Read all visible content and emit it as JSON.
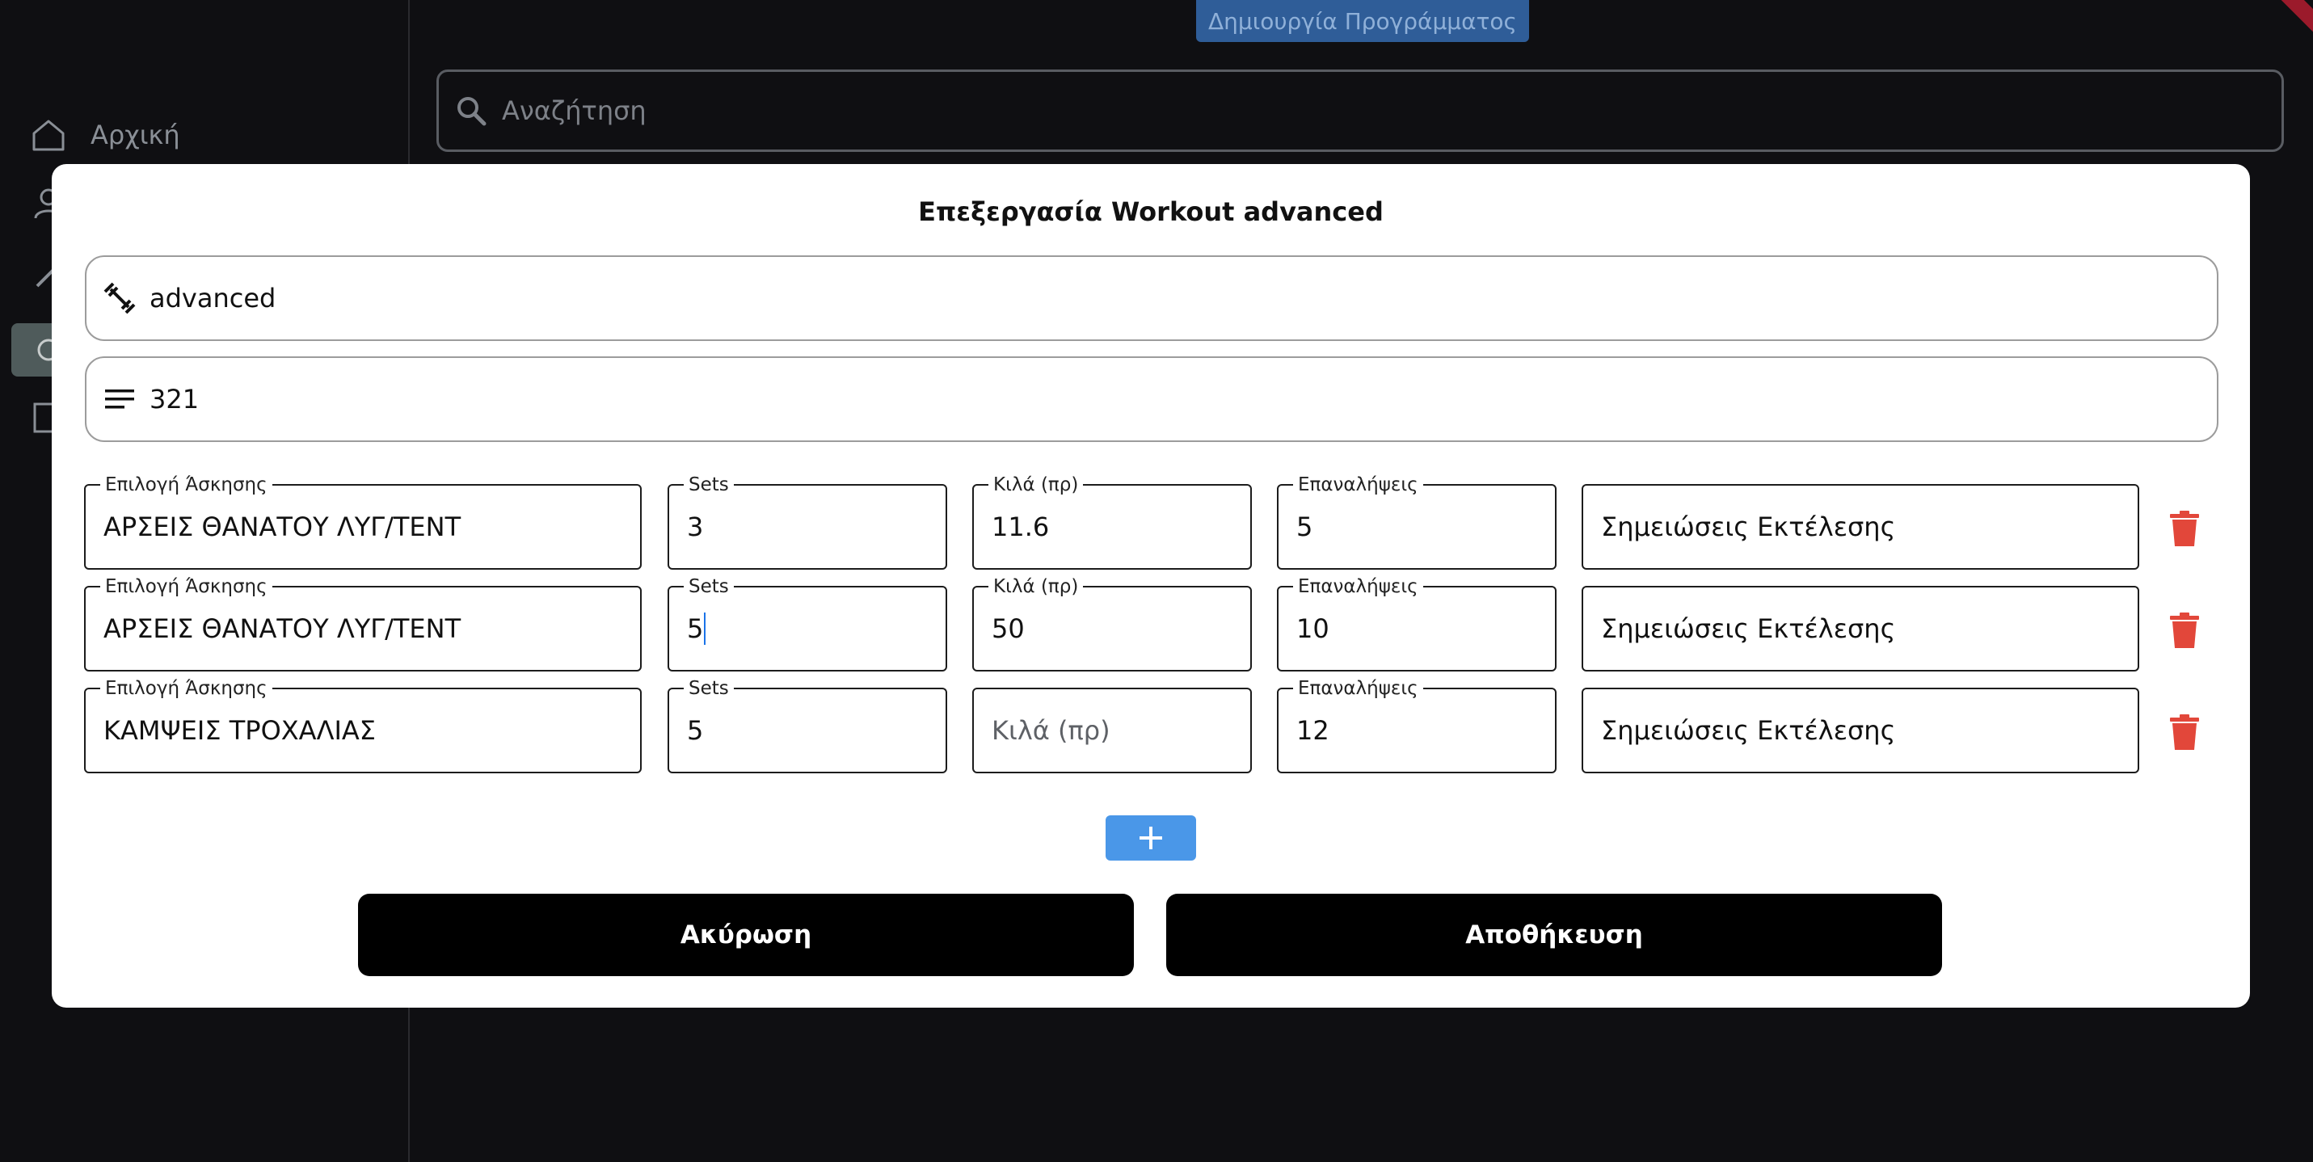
{
  "sidebar": {
    "home_label": "Αρχική"
  },
  "header": {
    "create_program_label": "Δημιουργία Προγράμματος"
  },
  "search": {
    "placeholder": "Αναζήτηση"
  },
  "modal": {
    "title": "Επεξεργασία Workout advanced",
    "name_value": "advanced",
    "description_value": "321",
    "field_labels": {
      "exercise": "Επιλογή Άσκησης",
      "sets": "Sets",
      "kg": "Κιλά (πρ)",
      "reps": "Επαναλήψεις"
    },
    "rows": [
      {
        "exercise": "ΑΡΣΕΙΣ ΘΑΝΑΤΟΥ ΛΥΓ/ΤΕΝΤ",
        "sets": "3",
        "kg": "11.6",
        "reps": "5",
        "notes_placeholder": "Σημειώσεις Εκτέλεσης"
      },
      {
        "exercise": "ΑΡΣΕΙΣ ΘΑΝΑΤΟΥ ΛΥΓ/ΤΕΝΤ",
        "sets": "5",
        "kg": "50",
        "reps": "10",
        "notes_placeholder": "Σημειώσεις Εκτέλεσης"
      },
      {
        "exercise": "ΚΑΜΨΕΙΣ ΤΡΟΧΑΛΙΑΣ",
        "sets": "5",
        "kg_placeholder": "Κιλά (πρ)",
        "reps": "12",
        "notes_placeholder": "Σημειώσεις Εκτέλεσης"
      }
    ],
    "cancel_label": "Ακύρωση",
    "save_label": "Αποθήκευση"
  },
  "icons": {
    "name_field": "dumbbell-icon",
    "description_field": "lines-icon",
    "delete": "trash-icon",
    "add": "plus-icon",
    "search": "search-icon",
    "home": "home-icon"
  },
  "colors": {
    "accent_blue": "#4a97e8",
    "delete_red": "#e2473a",
    "header_button": "#2f5d98"
  }
}
